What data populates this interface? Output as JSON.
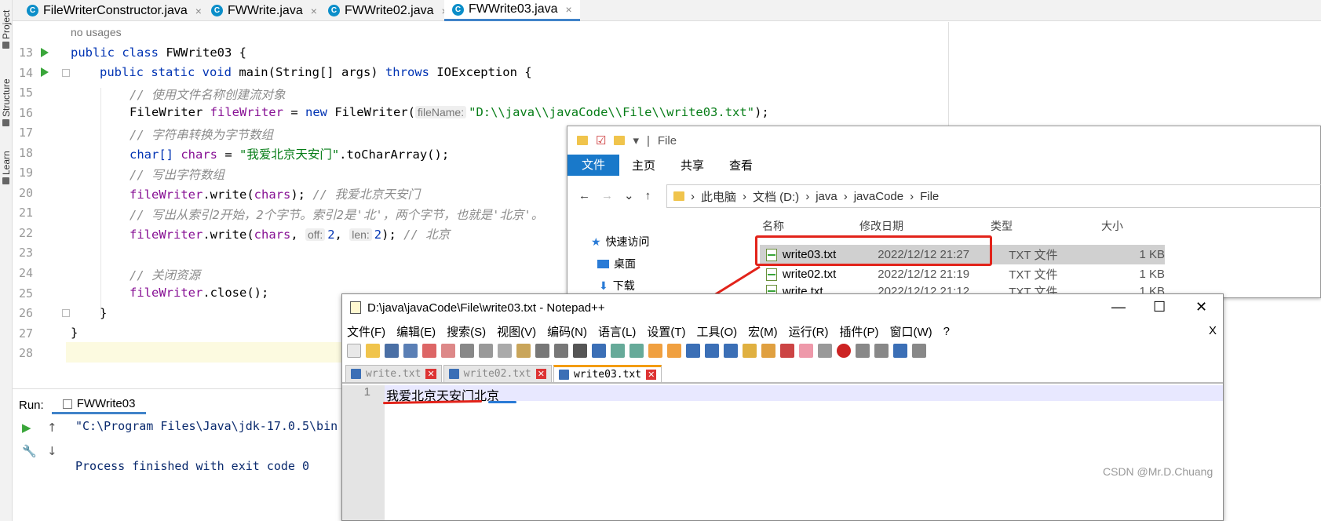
{
  "sidebar": {
    "project": "Project",
    "structure": "Structure",
    "learn": "Learn"
  },
  "tabs": [
    "FileWriterConstructor.java",
    "FWWrite.java",
    "FWWrite02.java",
    "FWWrite03.java"
  ],
  "editor": {
    "no_usages": "no usages",
    "line_numbers": [
      "13",
      "14",
      "15",
      "16",
      "17",
      "18",
      "19",
      "20",
      "21",
      "22",
      "23",
      "24",
      "25",
      "26",
      "27",
      "28"
    ],
    "line13": {
      "kw": "public class ",
      "name": "FWWrite03 {"
    },
    "line14": {
      "kw": "public static void ",
      "name": "main",
      "args": "(String[] args) ",
      "throws": "throws ",
      "rest": "IOException {"
    },
    "line15": "// 使用文件名称创建流对象",
    "line16": {
      "type": "FileWriter ",
      "var": "fileWriter",
      "eq": " = ",
      "new": "new ",
      "ctor": "FileWriter(",
      "hint": "fileName:",
      "str": "\"D:\\\\java\\\\javaCode\\\\File\\\\write03.txt\"",
      "end": ");"
    },
    "line17": "// 字符串转换为字节数组",
    "line18": {
      "type": "char[] ",
      "var": "chars",
      "eq": " = ",
      "str": "\"我爱北京天安门\"",
      "rest": ".toCharArray();"
    },
    "line19": "// 写出字符数组",
    "line20": {
      "var": "fileWriter",
      "rest": ".write(",
      "arg": "chars",
      "end": "); ",
      "comment": "// 我爱北京天安门"
    },
    "line21": "// 写出从索引2开始，2个字节。索引2是'北'，两个字节，也就是'北京'。",
    "line22": {
      "var": "fileWriter",
      "rest": ".write(",
      "arg": "chars",
      "sep": ", ",
      "hint1": "off:",
      "v1": "2",
      "hint2": "len:",
      "v2": "2",
      "end": "); ",
      "comment": "// 北京"
    },
    "line24": "// 关闭资源",
    "line25": {
      "var": "fileWriter",
      "rest": ".close();"
    },
    "line26": "}",
    "line27": "}"
  },
  "run": {
    "label": "Run:",
    "tab": "FWWrite03",
    "cmd": "\"C:\\Program Files\\Java\\jdk-17.0.5\\bin",
    "exit": "Process finished with exit code 0"
  },
  "explorer": {
    "qat_title": "File",
    "ribbon": [
      "文件",
      "主页",
      "共享",
      "查看"
    ],
    "breadcrumb": [
      "此电脑",
      "文档 (D:)",
      "java",
      "javaCode",
      "File"
    ],
    "columns": [
      "名称",
      "修改日期",
      "类型",
      "大小"
    ],
    "nav": [
      "快速访问",
      "桌面",
      "下载"
    ],
    "files": [
      {
        "name": "write03.txt",
        "date": "2022/12/12 21:27",
        "type": "TXT 文件",
        "size": "1 KB"
      },
      {
        "name": "write02.txt",
        "date": "2022/12/12 21:19",
        "type": "TXT 文件",
        "size": "1 KB"
      },
      {
        "name": "write.txt",
        "date": "2022/12/12 21:12",
        "type": "TXT 文件",
        "size": "1 KB"
      }
    ]
  },
  "notepad": {
    "title": "D:\\java\\javaCode\\File\\write03.txt - Notepad++",
    "menu": [
      "文件(F)",
      "编辑(E)",
      "搜索(S)",
      "视图(V)",
      "编码(N)",
      "语言(L)",
      "设置(T)",
      "工具(O)",
      "宏(M)",
      "运行(R)",
      "插件(P)",
      "窗口(W)",
      "?"
    ],
    "tabs": [
      "write.txt",
      "write02.txt",
      "write03.txt"
    ],
    "line_number": "1",
    "content_a": "我爱北京天安门",
    "content_b": "北京",
    "close_x": "X"
  },
  "watermark": "CSDN @Mr.D.Chuang",
  "colors": {
    "accent": "#4083c9",
    "annotation": "#e2231a",
    "underline_blue": "#2a7bd6"
  }
}
